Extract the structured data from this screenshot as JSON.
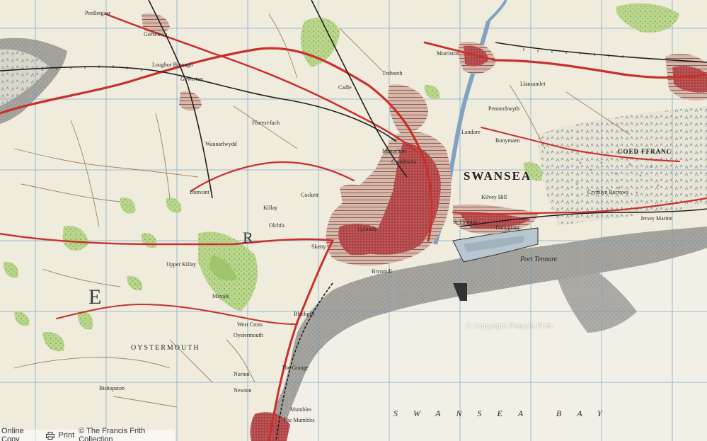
{
  "map": {
    "title": "SWANSEA",
    "bay_label": "SWANSEA BAY",
    "forest_label": "COED FFRANC",
    "district_label": "OYSTERMOUTH",
    "grid_letters": [
      "E",
      "R"
    ],
    "places": [
      "Gorseinon",
      "Loughor Borough",
      "Gowerton",
      "Dunvant",
      "Killay",
      "Sketty",
      "Mumbles",
      "Oystermouth",
      "Port Tennant",
      "Landore",
      "Morriston",
      "Llansamlet",
      "Cockett",
      "Brynmill",
      "Uplands",
      "Fforest-fach",
      "Waunarlwydd",
      "Penllergaer",
      "Blackpill",
      "Mayals",
      "West Cross",
      "Norton",
      "Newton",
      "The Grange",
      "The Mumbles",
      "Upper Killay",
      "Olchfa",
      "Bishopston",
      "Cadle",
      "Treboeth",
      "Manselton",
      "Cwmbwrla",
      "St Thomas",
      "Danygraig",
      "Kilvey Hill",
      "Bonymaen",
      "Pentrechwyth",
      "Crymlyn Burrows",
      "Jersey Marine"
    ],
    "colors": {
      "land": "#f0ecdf",
      "sea": "#a3a29d",
      "woodland": "#b7d48a",
      "urban": "#c9585a",
      "road": "#c8302c",
      "grid": "#6ea0c9",
      "rail": "#222222"
    }
  },
  "watermark": {
    "text": "© Copyright Francis Frith"
  },
  "footer": {
    "online_copy": "Online Copy",
    "print_link": "Print",
    "copyright": "© The Francis Frith Collection"
  },
  "icons": {
    "print": "printer-icon"
  }
}
